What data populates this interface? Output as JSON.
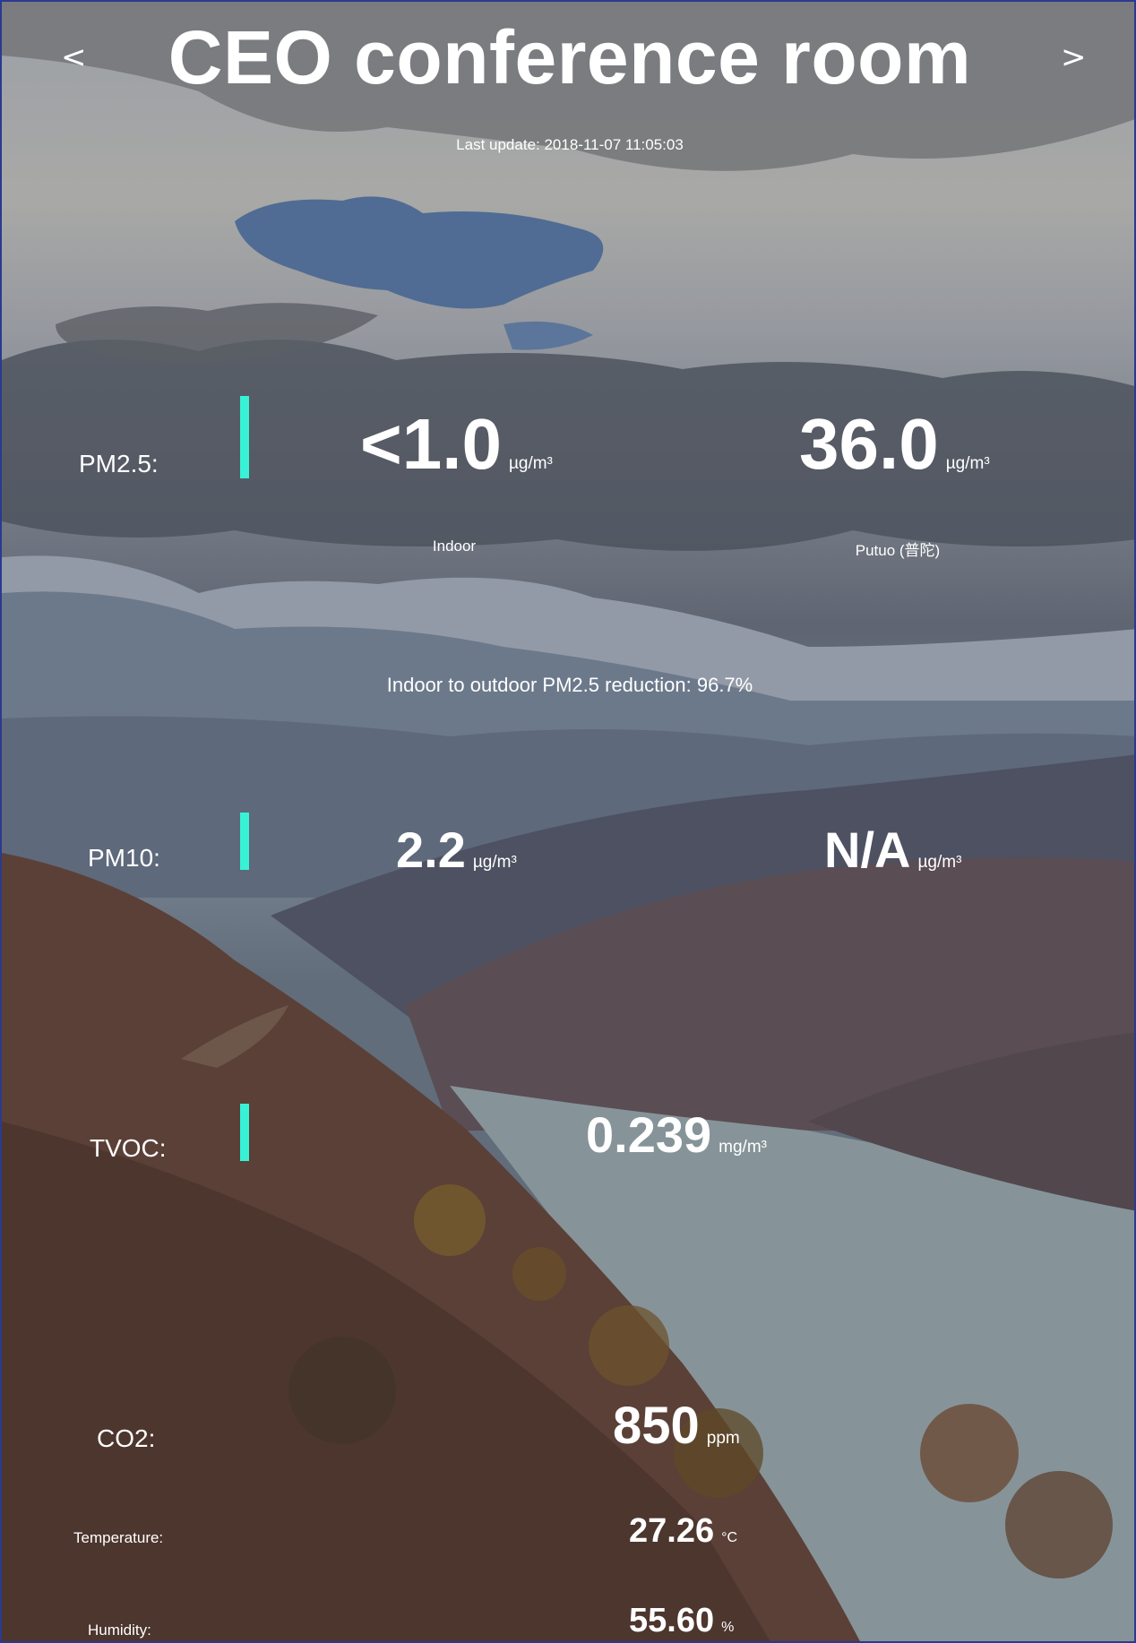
{
  "header": {
    "title": "CEO conference room",
    "prev_label": "<",
    "next_label": ">",
    "last_update": "Last update: 2018-11-07 11:05:03"
  },
  "colors": {
    "accent": "#38f2d6",
    "text": "#ffffff",
    "frame": "#2b3a8f"
  },
  "pm25": {
    "label": "PM2.5:",
    "indoor_value": "<1.0",
    "indoor_unit": "µg/m³",
    "outdoor_value": "36.0",
    "outdoor_unit": "µg/m³",
    "indoor_caption": "Indoor",
    "outdoor_caption": "Putuo (普陀)",
    "reduction": "Indoor to outdoor PM2.5 reduction: 96.7%"
  },
  "pm10": {
    "label": "PM10:",
    "indoor_value": "2.2",
    "indoor_unit": "µg/m³",
    "outdoor_value": "N/A",
    "outdoor_unit": "µg/m³"
  },
  "tvoc": {
    "label": "TVOC:",
    "value": "0.239",
    "unit": "mg/m³"
  },
  "co2": {
    "label": "CO2:",
    "value": "850",
    "unit": "ppm"
  },
  "temperature": {
    "label": "Temperature:",
    "value": "27.26",
    "unit": "°C"
  },
  "humidity": {
    "label": "Humidity:",
    "value": "55.60",
    "unit": "%"
  }
}
